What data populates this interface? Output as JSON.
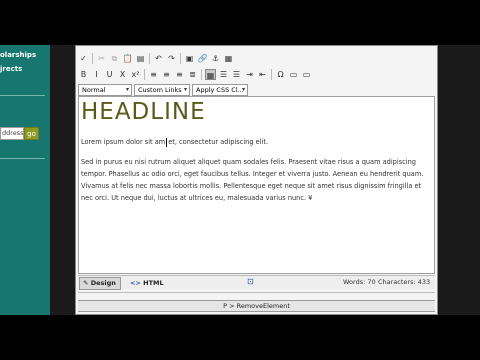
{
  "sidebar": {
    "link1": "olarships",
    "link2": "jrects",
    "search_value": "ddress",
    "go_label": "go"
  },
  "toolbar": {
    "row1": [
      {
        "icon": "spellcheck-icon",
        "glyph": "✓"
      },
      {
        "icon": "cut-icon",
        "glyph": "✂"
      },
      {
        "icon": "copy-icon",
        "glyph": "⧉"
      },
      {
        "icon": "paste-icon",
        "glyph": "📋"
      },
      {
        "icon": "paste-text-icon",
        "glyph": "▤"
      },
      {
        "icon": "undo-icon",
        "glyph": "↶"
      },
      {
        "icon": "redo-icon",
        "glyph": "↷"
      },
      {
        "icon": "image-icon",
        "glyph": "▣"
      },
      {
        "icon": "link-icon",
        "glyph": "🔗"
      },
      {
        "icon": "hyperlink-manager-icon",
        "glyph": "⚓"
      },
      {
        "icon": "document-manager-icon",
        "glyph": "▦"
      }
    ],
    "row2": [
      {
        "icon": "bold-icon",
        "glyph": "B"
      },
      {
        "icon": "italic-icon",
        "glyph": "I"
      },
      {
        "icon": "underline-icon",
        "glyph": "U"
      },
      {
        "icon": "strikethrough-icon",
        "glyph": "X"
      },
      {
        "icon": "superscript-icon",
        "glyph": "x²"
      },
      {
        "icon": "align-left-icon",
        "glyph": "≡"
      },
      {
        "icon": "align-center-icon",
        "glyph": "≡"
      },
      {
        "icon": "align-right-icon",
        "glyph": "≡"
      },
      {
        "icon": "justify-icon",
        "glyph": "≣"
      },
      {
        "icon": "table-icon",
        "glyph": "▦"
      },
      {
        "icon": "ordered-list-icon",
        "glyph": "☰"
      },
      {
        "icon": "bullet-list-icon",
        "glyph": "☰"
      },
      {
        "icon": "indent-icon",
        "glyph": "⇥"
      },
      {
        "icon": "outdent-icon",
        "glyph": "⇤"
      },
      {
        "icon": "special-chars-icon",
        "glyph": "Ω"
      },
      {
        "icon": "insert-table-icon",
        "glyph": "▭"
      },
      {
        "icon": "more-icon",
        "glyph": "▭"
      }
    ],
    "format_select": "Normal",
    "custom_links_select": "Custom Links",
    "css_class_select": "Apply CSS Cl..."
  },
  "content": {
    "headline": "HEADLINE",
    "para1_before": "Lorem ipsum dolor sit am",
    "para1_after": "et, consectetur adipiscing elit.",
    "para2": "Sed in purus eu nisi rutrum aliquet aliquet quam sodales felis. Praesent vitae risus a quam adipiscing tempor. Phasellus ac odio orci, eget faucibus tellus. Integer et viverra justo. Aenean eu hendrerit quam. Vivamus at felis nec massa lobortis mollis. Pellentesque eget neque sit amet risus dignissim fringilla et nec orci. Ut neque dui, luctus at ultrices eu, malesuada varius nunc. ¥"
  },
  "status": {
    "design_tab": "Design",
    "html_tab": "HTML",
    "words": "Words: 70",
    "characters": "Characters: 433"
  },
  "path_bar": "P > RemoveElement",
  "colors": {
    "sidebar_bg": "#17766f",
    "go_button": "#8d9a25",
    "headline": "#5a5a1a"
  }
}
